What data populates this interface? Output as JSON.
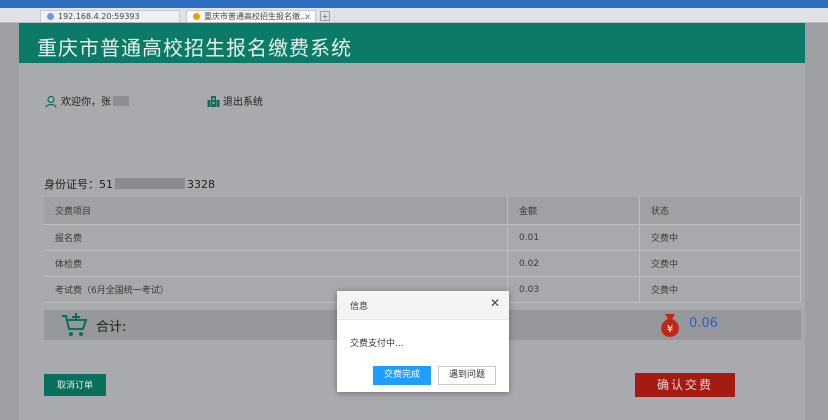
{
  "browser": {
    "tabs": [
      {
        "label": "192.168.4.20:59393"
      },
      {
        "label": "重庆市普通高校招生报名缴..."
      }
    ],
    "close_glyph": "×",
    "new_tab_glyph": "+"
  },
  "header": {
    "title": "重庆市普通高校招生报名缴费系统"
  },
  "user": {
    "welcome": "欢迎你，张",
    "logout_label": "退出系统"
  },
  "id_card": {
    "label": "身份证号：",
    "prefix": "51",
    "suffix": "3328"
  },
  "fee_table": {
    "headers": [
      "交费项目",
      "金额",
      "状态"
    ],
    "rows": [
      {
        "item": "报名费",
        "amount": "0.01",
        "status": "交费中"
      },
      {
        "item": "体检费",
        "amount": "0.02",
        "status": "交费中"
      },
      {
        "item": "考试费（6月全国统一考试）",
        "amount": "0.03",
        "status": "交费中"
      }
    ]
  },
  "total": {
    "label": "合计:",
    "amount": "0.06"
  },
  "actions": {
    "cancel_label": "取消订单",
    "confirm_label": "确认交费"
  },
  "dialog": {
    "title": "信息",
    "close_glyph": "✕",
    "message": "交费支付中...",
    "done_label": "交费完成",
    "problem_label": "遇到问题"
  },
  "colors": {
    "header_bg": "#0b7a66",
    "primary_button": "#1e9fff",
    "confirm_button": "#a51b14",
    "total_amount": "#2d62c4"
  }
}
